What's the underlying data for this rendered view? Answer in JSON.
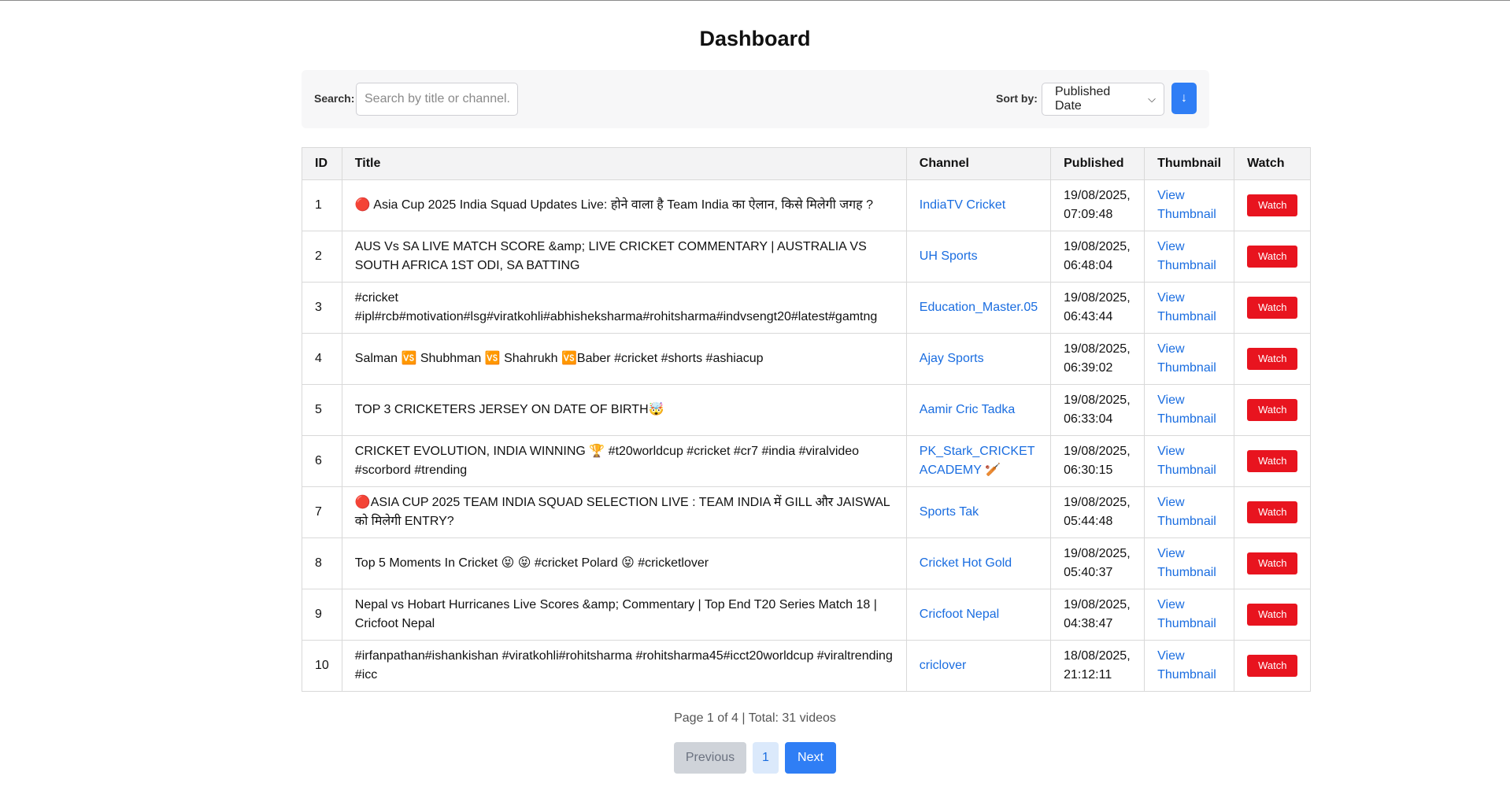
{
  "page": {
    "title": "Dashboard"
  },
  "controls": {
    "search_label": "Search:",
    "search_placeholder": "Search by title or channel...",
    "sort_label": "Sort by:",
    "sort_selected": "Published Date",
    "sort_direction_icon": "↓"
  },
  "table": {
    "headers": [
      "ID",
      "Title",
      "Channel",
      "Published",
      "Thumbnail",
      "Watch"
    ],
    "thumbnail_link": "View Thumbnail",
    "watch_label": "Watch",
    "rows": [
      {
        "id": "1",
        "title": "🔴 Asia Cup 2025 India Squad Updates Live: होने वाला है Team India का ऐलान, किसे मिलेगी जगह ?",
        "channel": "IndiaTV Cricket",
        "published": "19/08/2025, 07:09:48"
      },
      {
        "id": "2",
        "title": "AUS Vs SA LIVE MATCH SCORE &amp; LIVE CRICKET COMMENTARY | AUSTRALIA VS SOUTH AFRICA 1ST ODI, SA BATTING",
        "channel": "UH Sports",
        "published": "19/08/2025, 06:48:04"
      },
      {
        "id": "3",
        "title": "#cricket #ipl#rcb#motivation#lsg#viratkohli#abhisheksharma#rohitsharma#indvsengt20#latest#gamtng",
        "channel": "Education_Master.05",
        "published": "19/08/2025, 06:43:44"
      },
      {
        "id": "4",
        "title": "Salman 🆚 Shubhman 🆚 Shahrukh 🆚Baber #cricket #shorts #ashiacup",
        "channel": "Ajay Sports",
        "published": "19/08/2025, 06:39:02"
      },
      {
        "id": "5",
        "title": "TOP 3 CRICKETERS JERSEY ON DATE OF BIRTH🤯",
        "channel": "Aamir Cric Tadka",
        "published": "19/08/2025, 06:33:04"
      },
      {
        "id": "6",
        "title": "CRICKET EVOLUTION, INDIA WINNING 🏆 #t20worldcup #cricket #cr7 #india #viralvideo #scorbord #trending",
        "channel": "PK_Stark_CRICKET ACADEMY 🏏",
        "published": "19/08/2025, 06:30:15"
      },
      {
        "id": "7",
        "title": "🔴ASIA CUP 2025 TEAM INDIA SQUAD SELECTION LIVE : TEAM INDIA में GILL और JAISWAL को मिलेगी ENTRY?",
        "channel": "Sports Tak",
        "published": "19/08/2025, 05:44:48"
      },
      {
        "id": "8",
        "title": "Top 5 Moments In Cricket 😝 😝  #cricket Polard 😝  #cricketlover",
        "channel": "Cricket Hot Gold",
        "published": "19/08/2025, 05:40:37"
      },
      {
        "id": "9",
        "title": "Nepal vs Hobart Hurricanes Live Scores &amp; Commentary | Top End T20 Series Match 18 | Cricfoot Nepal",
        "channel": "Cricfoot Nepal",
        "published": "19/08/2025, 04:38:47"
      },
      {
        "id": "10",
        "title": "#irfanpathan#ishankishan #viratkohli#rohitsharma #rohitsharma45#icct20worldcup #viraltrending #icc",
        "channel": "criclover",
        "published": "18/08/2025, 21:12:11"
      }
    ]
  },
  "pagination": {
    "info": "Page 1 of 4 | Total: 31 videos",
    "previous": "Previous",
    "current_page": "1",
    "next": "Next"
  }
}
